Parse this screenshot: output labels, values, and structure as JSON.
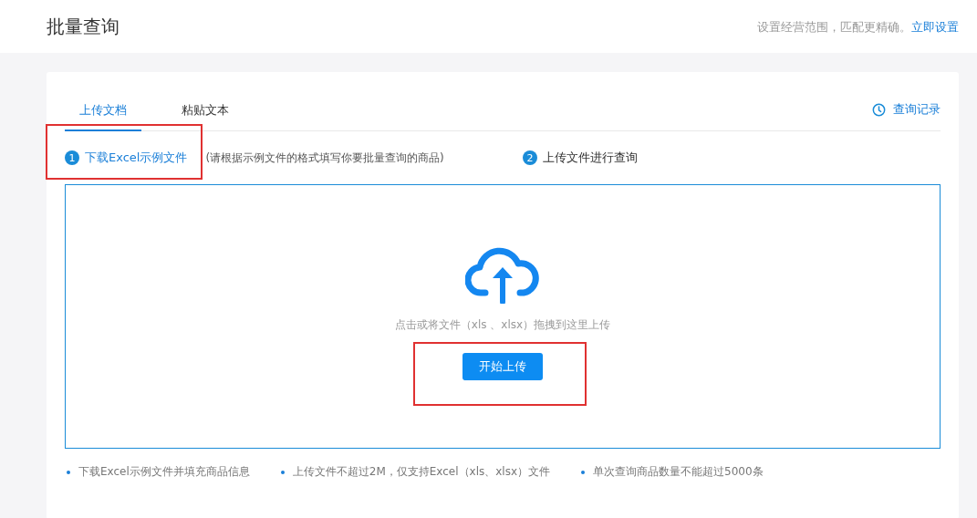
{
  "header": {
    "title": "批量查询",
    "hint": "设置经营范围，匹配更精确。",
    "link": "立即设置"
  },
  "tabs": [
    {
      "label": "上传文档",
      "selected": true
    },
    {
      "label": "粘贴文本",
      "selected": false
    }
  ],
  "history_link": "查询记录",
  "steps": [
    {
      "number": "1",
      "label": "下载Excel示例文件",
      "note": "(请根据示例文件的格式填写你要批量查询的商品)",
      "link": true,
      "highlighted": true
    },
    {
      "number": "2",
      "label": "上传文件进行查询",
      "link": false,
      "highlighted": false
    }
  ],
  "dropzone": {
    "hint": "点击或将文件（xls 、xlsx）拖拽到这里上传",
    "button": "开始上传",
    "button_highlighted": true
  },
  "notes": [
    "下载Excel示例文件并填充商品信息",
    "上传文件不超过2M，仅支持Excel（xls、xlsx）文件",
    "单次查询商品数量不能超过5000条"
  ]
}
